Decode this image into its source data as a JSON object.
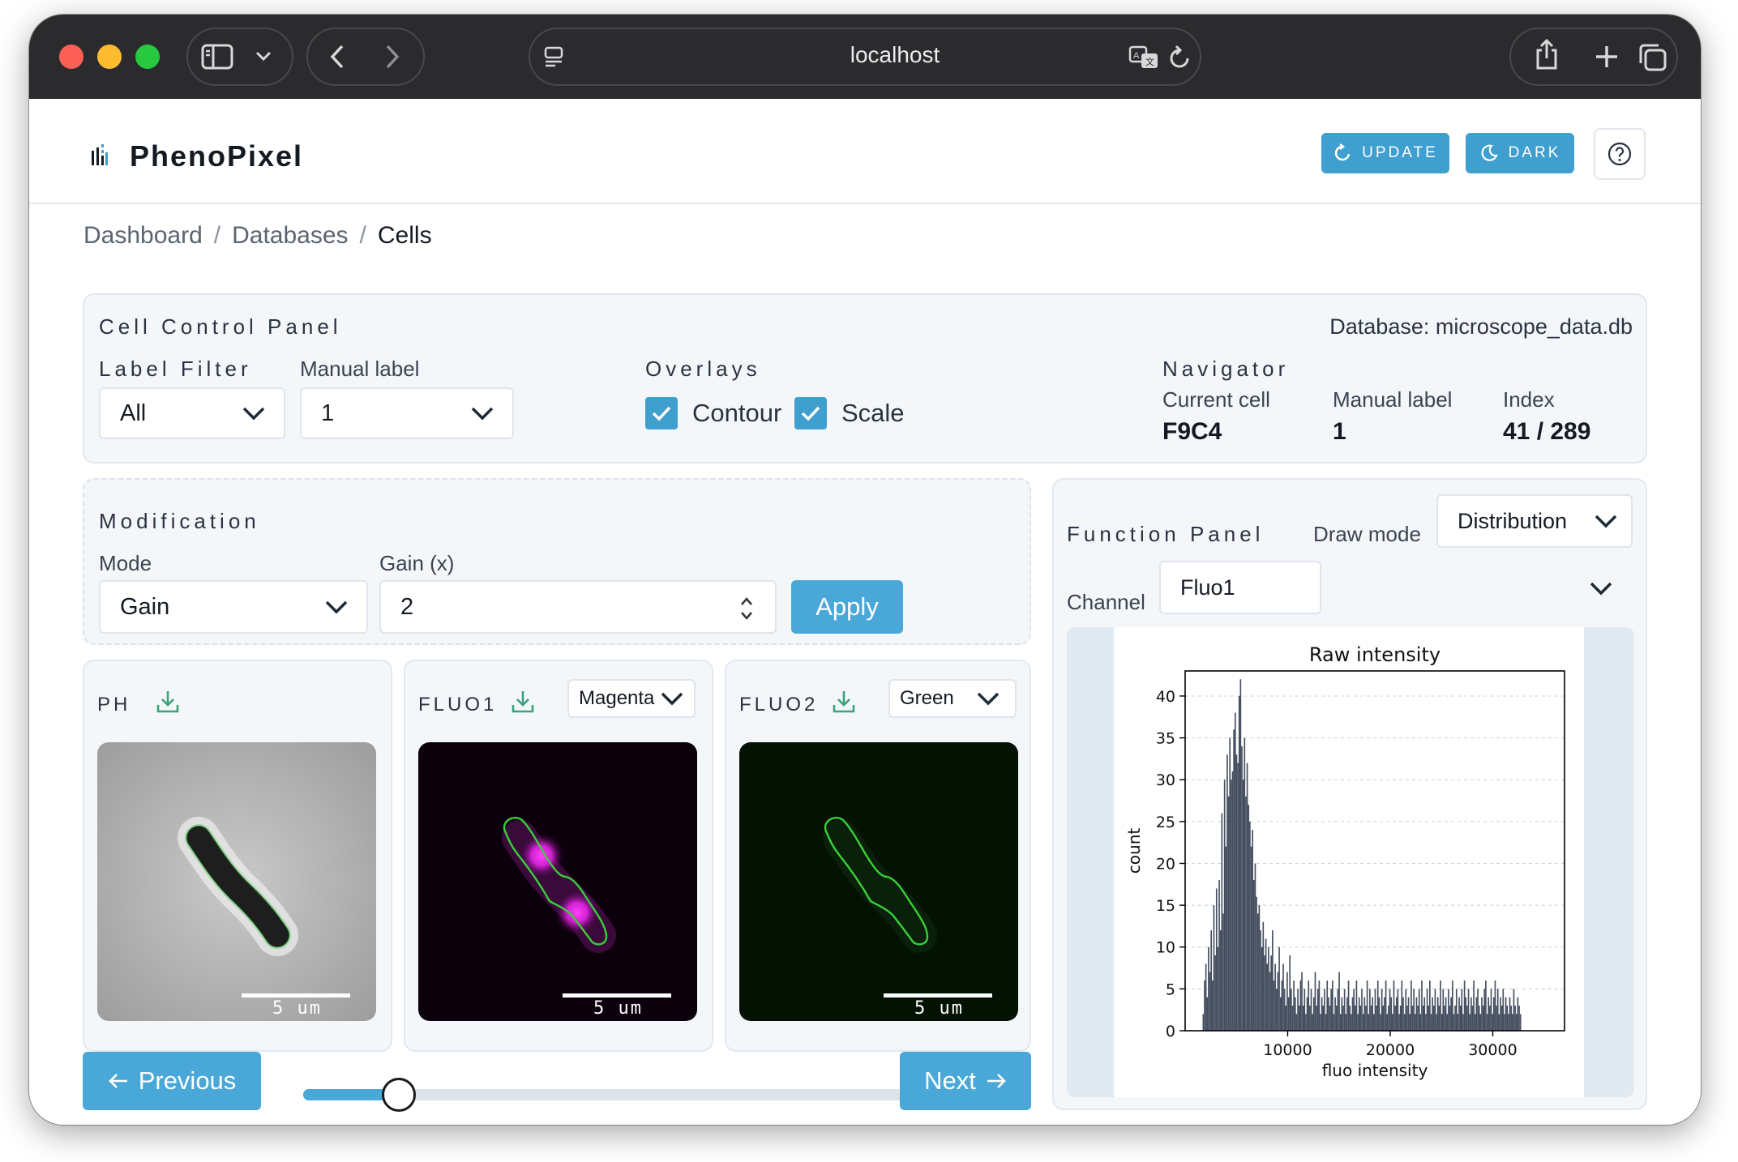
{
  "browser": {
    "url": "localhost"
  },
  "app": {
    "name": "PhenoPixel",
    "update_label": "UPDATE",
    "dark_label": "DARK"
  },
  "breadcrumb": {
    "items": [
      "Dashboard",
      "Databases",
      "Cells"
    ]
  },
  "cell_control_panel": {
    "title": "Cell Control Panel",
    "database": "Database: microscope_data.db",
    "label_filter": {
      "label": "Label Filter",
      "value": "All"
    },
    "manual_label": {
      "label": "Manual label",
      "value": "1"
    },
    "overlays": {
      "title": "Overlays",
      "contour": {
        "label": "Contour",
        "checked": true
      },
      "scale": {
        "label": "Scale",
        "checked": true
      }
    },
    "navigator": {
      "title": "Navigator",
      "current_cell_label": "Current cell",
      "current_cell": "F9C4",
      "manual_label_label": "Manual label",
      "manual_label": "1",
      "index_label": "Index",
      "index": "41 / 289"
    }
  },
  "modification": {
    "title": "Modification",
    "mode_label": "Mode",
    "mode": "Gain",
    "gain_label": "Gain (x)",
    "gain": "2",
    "apply_label": "Apply"
  },
  "images": [
    {
      "title": "PH",
      "scale": "5 um"
    },
    {
      "title": "FLUO1",
      "color": "Magenta",
      "scale": "5 um"
    },
    {
      "title": "FLUO2",
      "color": "Green",
      "scale": "5 um"
    }
  ],
  "navigation": {
    "previous": "Previous",
    "next": "Next",
    "position": 41,
    "total": 289
  },
  "function_panel": {
    "title": "Function Panel",
    "draw_mode_label": "Draw mode",
    "draw_mode": "Distribution",
    "channel_label": "Channel",
    "channel": "Fluo1"
  },
  "chart_data": {
    "type": "bar",
    "title": "Raw intensity",
    "xlabel": "fluo intensity",
    "ylabel": "count",
    "xlim": [
      0,
      37000
    ],
    "ylim": [
      0,
      43
    ],
    "xticks": [
      10000,
      20000,
      30000
    ],
    "xtick_labels": [
      "10000",
      "20000",
      "30000"
    ],
    "yticks": [
      0,
      5,
      10,
      15,
      20,
      25,
      30,
      35,
      40
    ],
    "ytick_labels": [
      "0",
      "5",
      "10",
      "15",
      "20",
      "25",
      "30",
      "35",
      "40"
    ],
    "grid": true,
    "bar_color": "#444e5f",
    "bin_edges_start": 1700,
    "bin_width": 130,
    "values": [
      2,
      6,
      8,
      4,
      10,
      7,
      12,
      6,
      15,
      9,
      17,
      10,
      18,
      12,
      26,
      14,
      30,
      22,
      33,
      28,
      35,
      30,
      31,
      36,
      38,
      33,
      32,
      40,
      42,
      34,
      30,
      35,
      28,
      32,
      27,
      25,
      22,
      24,
      18,
      20,
      16,
      14,
      15,
      12,
      10,
      13,
      9,
      11,
      8,
      10,
      7,
      9,
      12,
      6,
      8,
      5,
      7,
      10,
      4,
      6,
      8,
      5,
      3,
      7,
      4,
      9,
      5,
      3,
      6,
      4,
      2,
      5,
      3,
      6,
      7,
      3,
      5,
      2,
      4,
      6,
      3,
      5,
      2,
      4,
      7,
      3,
      5,
      6,
      2,
      4,
      3,
      5,
      2,
      6,
      4,
      3,
      5,
      6,
      2,
      4,
      3,
      5,
      7,
      2,
      4,
      3,
      5,
      2,
      4,
      6,
      3,
      2,
      4,
      5,
      3,
      6,
      2,
      4,
      3,
      5,
      2,
      4,
      3,
      6,
      2,
      5,
      3,
      4,
      2,
      5,
      3,
      6,
      4,
      2,
      5,
      3,
      4,
      6,
      2,
      3,
      5,
      4,
      2,
      6,
      3,
      4,
      5,
      2,
      3,
      6,
      4,
      2,
      5,
      3,
      4,
      2,
      6,
      3,
      5,
      2,
      4,
      3,
      5,
      2,
      6,
      3,
      4,
      2,
      5,
      3,
      6,
      2,
      4,
      3,
      5,
      2,
      4,
      3,
      6,
      2,
      5,
      3,
      4,
      2,
      5,
      3,
      4,
      6,
      2,
      3,
      5,
      2,
      4,
      3,
      5,
      2,
      6,
      4,
      3,
      5,
      2,
      4,
      3,
      6,
      2,
      4,
      5,
      3,
      2,
      4,
      3,
      5,
      6,
      2,
      4,
      3,
      5,
      2,
      4,
      6,
      3,
      5,
      2,
      4,
      3,
      5,
      2,
      4,
      3,
      2,
      4,
      3,
      2,
      5,
      3,
      2,
      4,
      3,
      2
    ]
  }
}
